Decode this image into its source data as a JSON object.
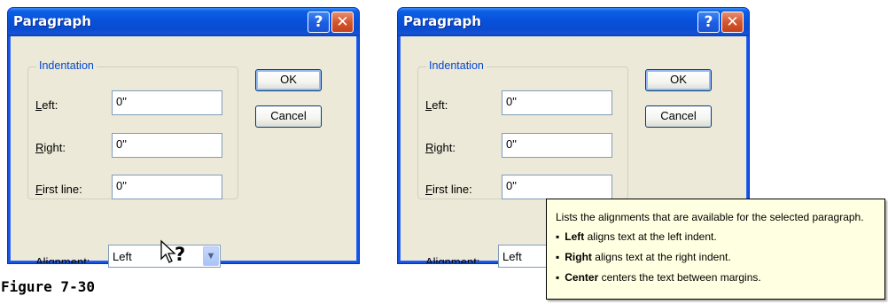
{
  "dialogs": [
    {
      "title": "Paragraph",
      "help_glyph": "?",
      "close_glyph": "✕",
      "indentation_label": "Indentation",
      "left_label": "Left:",
      "left_value": "0\"",
      "right_label": "Right:",
      "right_value": "0\"",
      "first_line_label": "First line:",
      "first_line_value": "0\"",
      "ok_label": "OK",
      "cancel_label": "Cancel",
      "alignment_label": "Alignment:",
      "alignment_value": "Left"
    },
    {
      "title": "Paragraph",
      "help_glyph": "?",
      "close_glyph": "✕",
      "indentation_label": "Indentation",
      "left_label": "Left:",
      "left_value": "0\"",
      "right_label": "Right:",
      "right_value": "0\"",
      "first_line_label": "First line:",
      "first_line_value": "0\"",
      "ok_label": "OK",
      "cancel_label": "Cancel",
      "alignment_label": "Alignment:",
      "alignment_value": "Left"
    }
  ],
  "tooltip": {
    "intro": "Lists the alignments that are available for the selected paragraph.",
    "items": [
      {
        "term": "Left",
        "desc": "aligns text at the left indent."
      },
      {
        "term": "Right",
        "desc": "aligns text at the right indent."
      },
      {
        "term": "Center",
        "desc": "centers the text between margins."
      }
    ]
  },
  "figure_caption": "Figure 7-30",
  "icons": {
    "help_cursor": "help-cursor-icon",
    "dropdown_arrow": "chevron-down-icon"
  },
  "colors": {
    "titlebar": "#0851db",
    "dialog_bg": "#ece9d8",
    "tooltip_bg": "#ffffe1",
    "group_label": "#0046d5"
  }
}
